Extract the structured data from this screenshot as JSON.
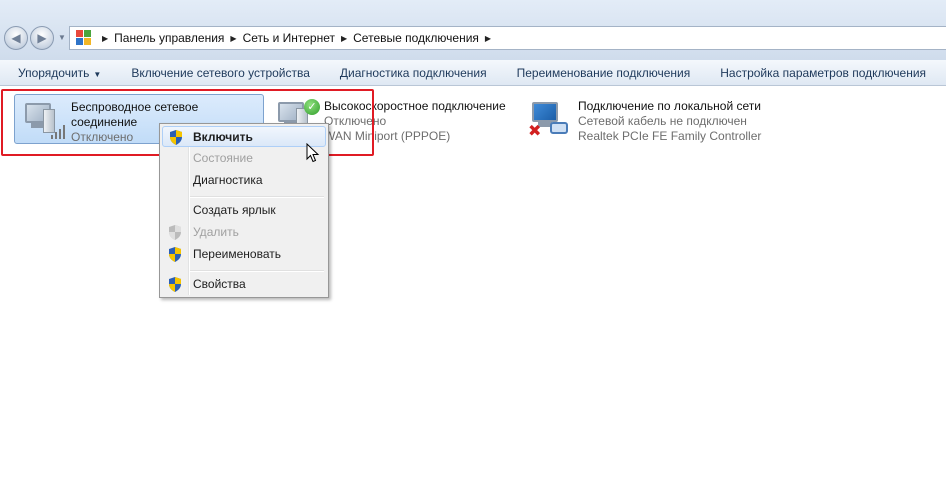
{
  "address_bar": {
    "back_icon": "back-arrow-icon",
    "forward_icon": "forward-arrow-icon",
    "location_icon": "control-panel-icon",
    "breadcrumbs": [
      "Панель управления",
      "Сеть и Интернет",
      "Сетевые подключения"
    ]
  },
  "toolbar": {
    "organize": "Упорядочить",
    "enable_device": "Включение сетевого устройства",
    "diagnose": "Диагностика подключения",
    "rename": "Переименование подключения",
    "settings": "Настройка параметров подключения"
  },
  "connections": [
    {
      "name_line1": "Беспроводное сетевое",
      "name_line2": "соединение",
      "status": "Отключено",
      "icon": "wireless-adapter-icon"
    },
    {
      "name_line1": "Высокоскоростное подключение",
      "status": "Отключено",
      "device": "WAN Miniport (PPPOE)",
      "icon": "broadband-connection-icon"
    },
    {
      "name_line1": "Подключение по локальной сети",
      "status": "Сетевой кабель не подключен",
      "device": "Realtek PCIe FE Family Controller",
      "icon": "lan-connection-icon"
    }
  ],
  "context_menu": {
    "enable": "Включить",
    "status": "Состояние",
    "diagnostics": "Диагностика",
    "create_shortcut": "Создать ярлык",
    "delete": "Удалить",
    "rename": "Переименовать",
    "properties": "Свойства"
  },
  "colors": {
    "highlight_border": "#e01b24",
    "selection_bg": "#cde3fa",
    "toolbar_text": "#1e395b"
  }
}
